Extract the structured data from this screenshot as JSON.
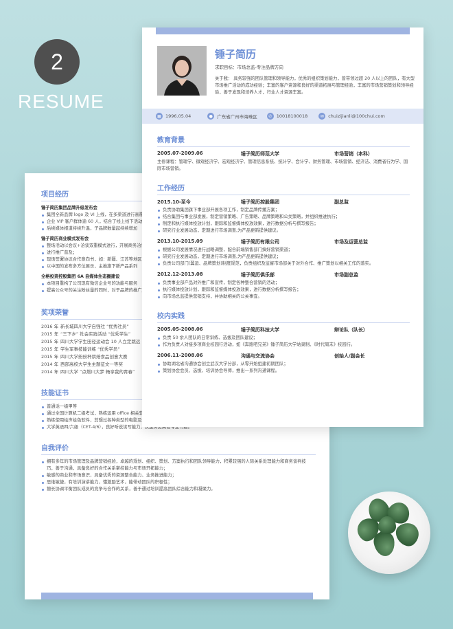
{
  "badge": {
    "number": "2",
    "word": "RESUME"
  },
  "profile": {
    "name": "锤子简历",
    "job_label": "求职目标：",
    "job": "市场总监-专注品牌方向",
    "about": "关于我： 具务较强的团队管理和领导能力，优秀的组织策划能力，曾带领过超 20 人以上的团队，有大型市场推广活动的成功经验；丰富的客户资源和良好的渠道拓展与管理经验，丰富的市场营销策划和领导经验，善于发现和培养人才，行业人才资源丰富。",
    "contacts": [
      {
        "icon": "calendar-icon",
        "text": "1996.05.04"
      },
      {
        "icon": "location-icon",
        "text": "广东省广州市海珠区"
      },
      {
        "icon": "phone-icon",
        "text": "10018100018"
      },
      {
        "icon": "mail-icon",
        "text": "chuizijianli@100chui.com"
      }
    ]
  },
  "education": {
    "title": "教育背景",
    "entries": [
      {
        "date": "2005.07-2009.06",
        "org": "锤子简历师范大学",
        "role": "市场营销（本科）",
        "text": "主修课程：管理学、微观经济学、宏观经济学、管理信息系统、统计学、会计学、财务管理、市场营销、经济法、消费者行为学、国际市场营销。"
      }
    ]
  },
  "work": {
    "title": "工作经历",
    "entries": [
      {
        "date": "2015.10-至今",
        "org": "锤子简历控股集团",
        "role": "副总监",
        "items": [
          "负责协助集团旗下事业部开展各项工作，制定品牌传播方案；",
          "结合集团与事业部发展，制定营销策略、广告策略、品牌策略和公关策略，并组织推进执行；",
          "制定和执行媒体投放计划，跟踪和监督媒体投放效果，进行数据分析与撰写报告；",
          "研究行业发展动态，定期进行市场调查,为产品更新提供建议。"
        ]
      },
      {
        "date": "2013.10-2015.09",
        "org": "锤子简历有限公司",
        "role": "市场及运营总监",
        "items": [
          "根据公司发展情况进行战略调整，配合前端销售部门搞好营销渠道；",
          "研究行业发展动态，定期进行市场调查,为产品更新提供建议；",
          "负责公司部门(翼运、品牌策划)制度规范，负责组织及监督市场部关于对外合作、推广策划以相关工作的落实。"
        ]
      },
      {
        "date": "2012.12-2013.08",
        "org": "锤子简历俱乐部",
        "role": "市场副总监",
        "items": [
          "负责事业部产品对外推广和宣传，制定各种整合营销的活动；",
          "执行媒体投放计划，跟踪和监督媒体投放效果，进行数据分析撰写报告；",
          "向市场总监提供营销支持，并协助相关的公关事宜。"
        ]
      }
    ]
  },
  "campus": {
    "title": "校内实践",
    "entries": [
      {
        "date": "2005.05-2008.06",
        "org": "锤子简历科技大学",
        "role": "辩论队（队长）",
        "items": [
          "负责 50 余人团队的日常训练、选拔及团队建设；",
          "作为负责人对接多项商业校园行活动，如《奔跑吧兄弟》锤子简历大学站录制、《时代周末》校园行。"
        ]
      },
      {
        "date": "2006.11-2008.06",
        "org": "沟通与交流协会",
        "role": "创始人/副会长",
        "items": [
          "协助湖北省沟通协会创立武汉大学分部，从零开始组建初期团队；",
          "策划协会会员、选拔、培训协会导师，推出一系列沟通课程。"
        ]
      }
    ]
  },
  "projects": {
    "title": "项目经历",
    "entries": [
      {
        "name": "锤子简历集团品牌升级发布会",
        "items": [
          "集团全新品牌 logo 及 VI 上线，在多渠道进行高覆盖推广",
          "企业 VIP 客户群体逾 60 人，结合了线上线下活动推广",
          "后续媒体报道持续升温，子品牌数量起持续增加"
        ]
      },
      {
        "name": "锤子简历商业模式发布会",
        "items": [
          "整场活动以会议+洽谈双重模式进行，开展商务洽谈",
          "进行推广普及；",
          "现场签署协议合作意向书，如：新疆、江苏等地区",
          "以中国的发布多方位展示，主推旗下新产品系列"
        ]
      },
      {
        "name": "全格投资控股集团 6A 自媒体生态圈建设",
        "items": [
          "本项目重构了公司现有微信企业号的功能与服务",
          "提高公众号的关注粉丝量的同时，对于品牌的推广起到"
        ]
      }
    ]
  },
  "awards": {
    "title": "奖项荣誉",
    "entries": [
      {
        "year": "2016 年",
        "text": "新长城四川大学自强社 “优秀社员”"
      },
      {
        "year": "2015 年",
        "text": "“三下乡” 社会实践活动 “优秀学生”"
      },
      {
        "year": "2015 年",
        "text": "四川大学学生田径运动会 10 人立定跳远"
      },
      {
        "year": "2015 年",
        "text": "学生军事技能训练 “优秀学员”"
      },
      {
        "year": "2015 年",
        "text": "四川大学纷纷杯烘焙食品创意大赛"
      },
      {
        "year": "2014 年",
        "text": "西部高校大学生主题征文一等奖"
      },
      {
        "year": "2014 年",
        "text": "四川大学 “点燃川大梦 畅享我的青春”"
      }
    ]
  },
  "skills": {
    "title": "技能证书",
    "items": [
      "普通话一级甲等",
      "通过全国计算机二级考试，熟练运用 office 相关软件。",
      "熟练使用绘声绘色软件，剪辑过各种类型的电影及班级视频。",
      "大学英语四/六级（CET-4/6），良好听说读写能力，快速浏览英语专业书籍。"
    ]
  },
  "self": {
    "title": "自我评价",
    "items": [
      "拥有多年的市场管理及品牌营销经验，卓越的规划、组织、策划、方案执行和团队领导能力，积累较强的人际关系处理能力和商务谈判技巧，善于沟通，具备良好的合作关系掌控能力与市场开拓能力；",
      "敏感的商业和市场意识，具备优秀的资源整合能力、业务推进能力；",
      "思维敏捷，有培训演讲能力，懂激励艺术，能带动团队的积极性；",
      "擅长协调平衡团队成员的竞争与合作的关系，善于通过培训提高团队综合能力和凝聚力。"
    ]
  }
}
